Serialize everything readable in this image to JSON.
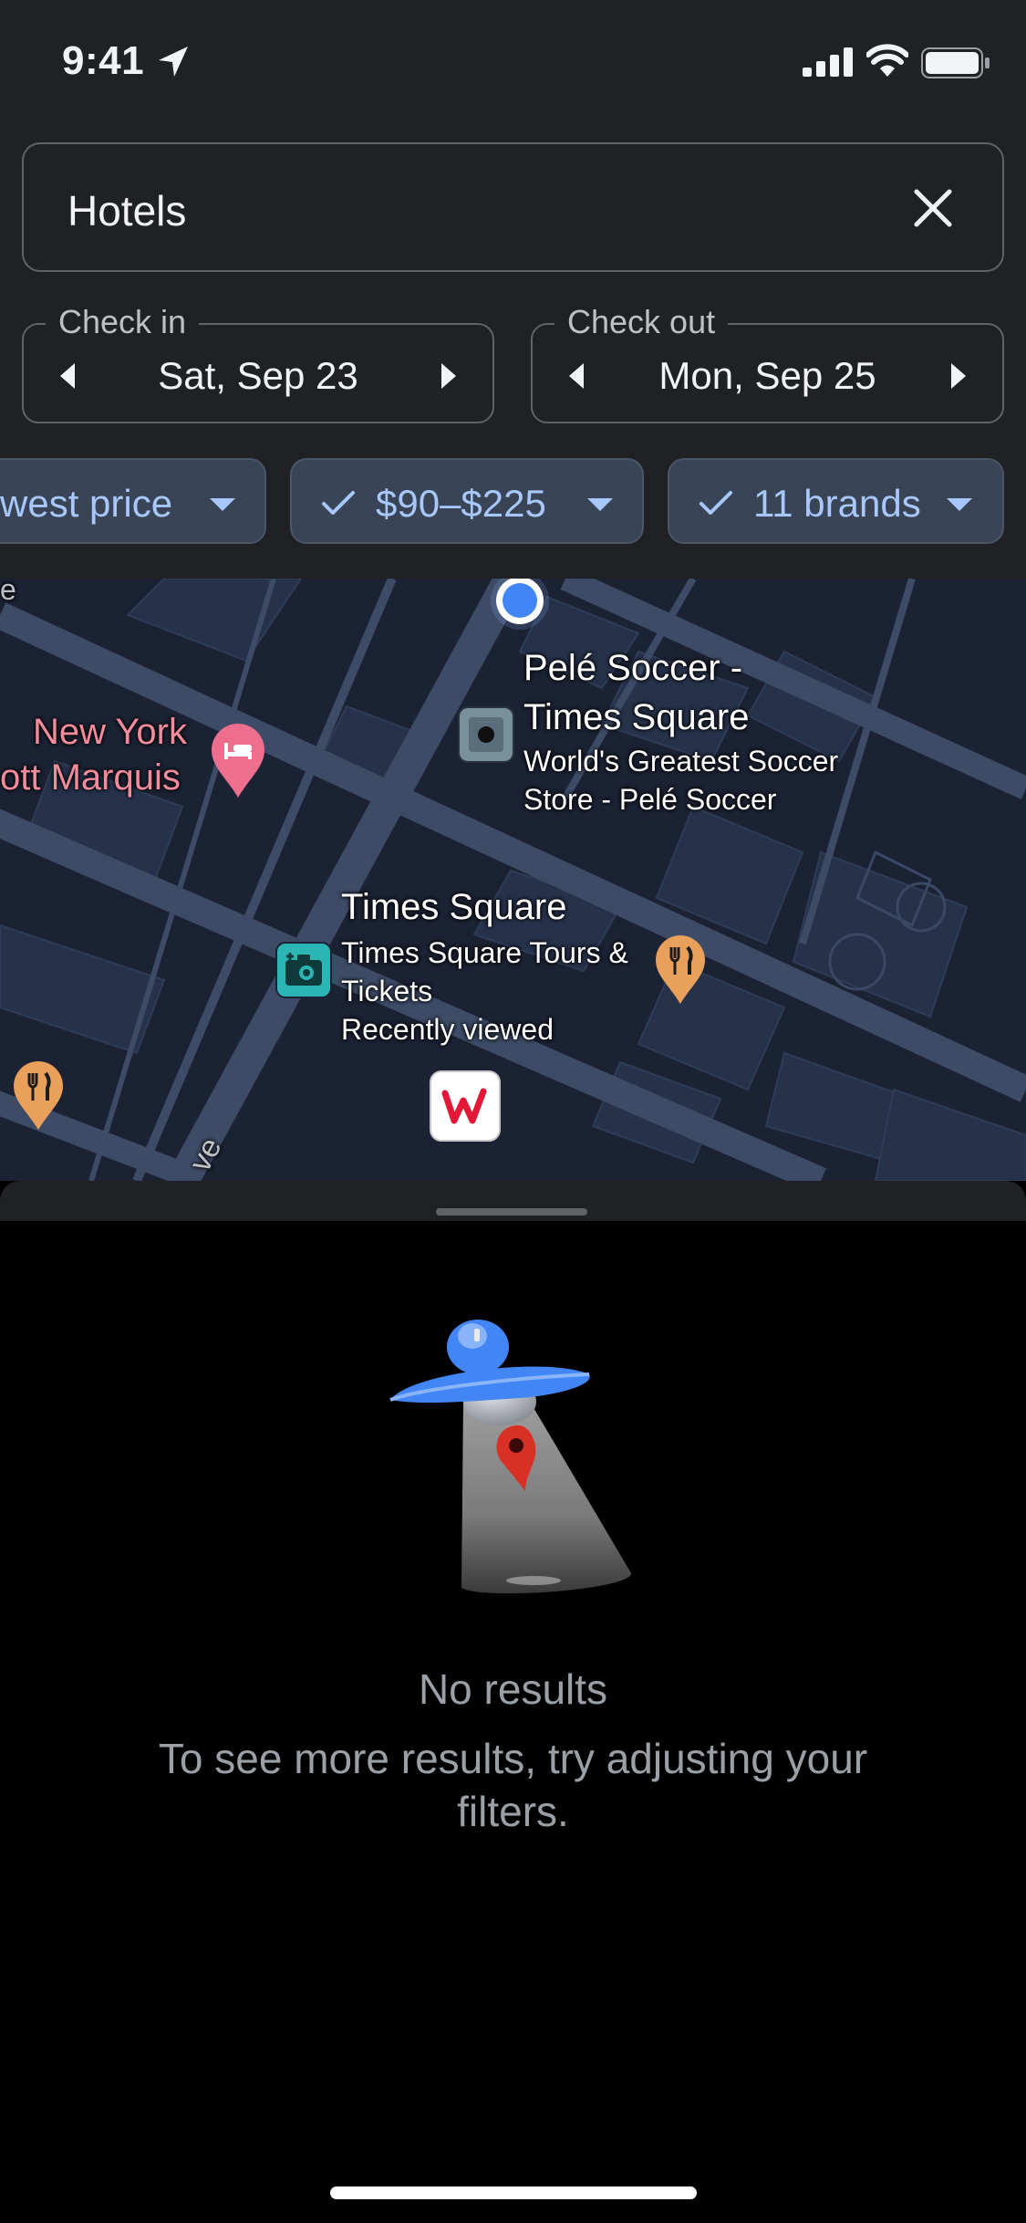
{
  "status_bar": {
    "time": "9:41",
    "icons": [
      "location-arrow-icon",
      "cellular-signal-icon",
      "wifi-icon",
      "battery-icon"
    ]
  },
  "search": {
    "value": "Hotels",
    "clear_icon": "close-icon"
  },
  "dates": {
    "check_in": {
      "label": "Check in",
      "value": "Sat, Sep 23"
    },
    "check_out": {
      "label": "Check out",
      "value": "Mon, Sep 25"
    }
  },
  "filters": [
    {
      "label": "west price",
      "checked": false
    },
    {
      "label": "$90–$225",
      "checked": true
    },
    {
      "label": "11 brands",
      "checked": true
    }
  ],
  "map": {
    "pins": [
      {
        "title": "New York",
        "title_line2": "ott Marquis",
        "icon": "hotel-pin-icon"
      },
      {
        "title": "Pelé Soccer -",
        "title_line2": "Times Square",
        "subtitle": "World's Greatest Soccer",
        "subtitle_line2": "Store - Pelé Soccer",
        "icon": "store-icon"
      },
      {
        "title": "Times Square",
        "subtitle": "Times Square Tours &",
        "subtitle_line2": "Tickets",
        "note": "Recently viewed",
        "icon": "camera-icon"
      }
    ],
    "street_fragment": "ve",
    "edge_fragment": "e",
    "colors": {
      "background": "#1b2233",
      "roads": "#3d4b66",
      "blocks": "#26324a"
    }
  },
  "empty_state": {
    "title": "No results",
    "message": "To see more results, try adjusting your filters.",
    "illustration": "ufo-illustration"
  },
  "colors": {
    "panel_bg": "#202124",
    "chip_bg": "#394457",
    "chip_text": "#a8c7fa",
    "outline": "#5f6368",
    "muted_text": "#9aa0a6"
  }
}
